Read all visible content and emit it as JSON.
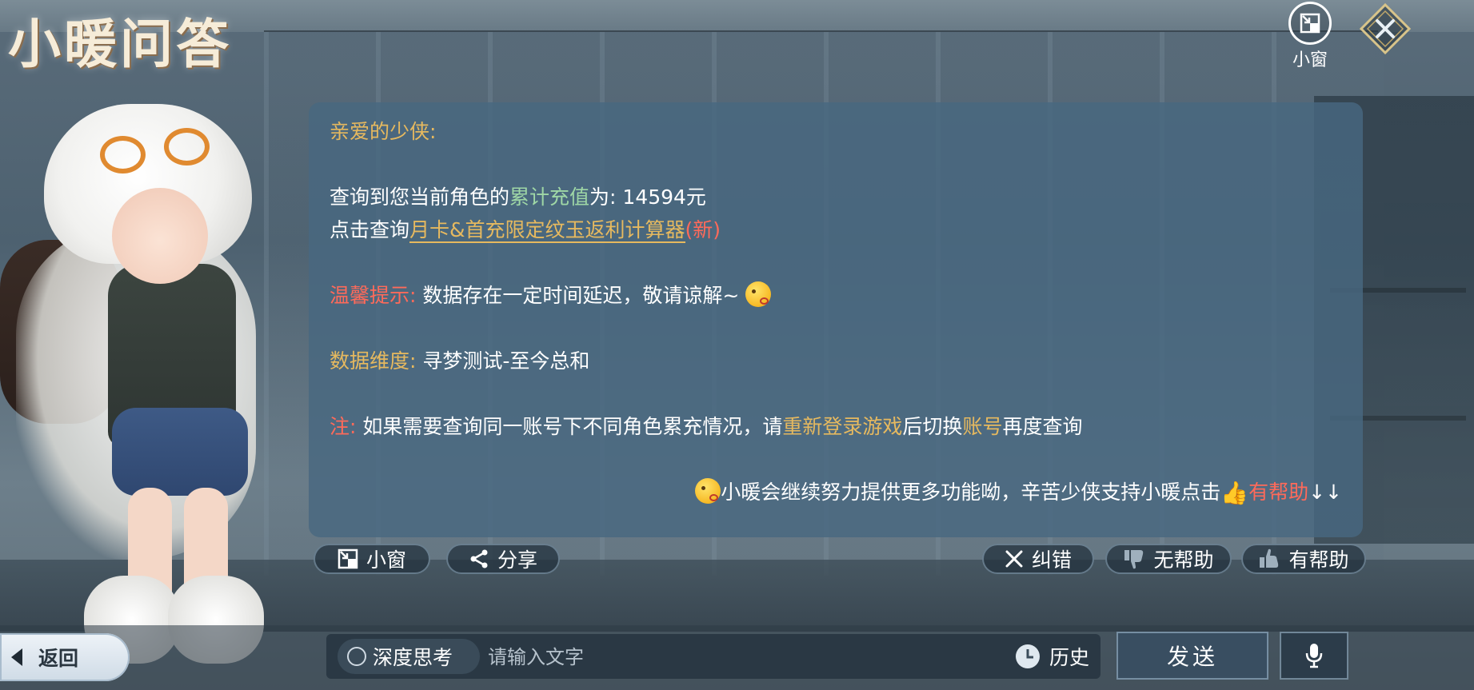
{
  "app": {
    "title": "小暖问答"
  },
  "top_controls": {
    "mini_window_label": "小窗"
  },
  "message": {
    "greeting": "亲爱的少侠:",
    "line1_prefix": "查询到您当前角色的",
    "line1_highlight": "累计充值",
    "line1_suffix": "为: 14594元",
    "line2_prefix": "点击查询",
    "line2_link": "月卡&首充限定纹玉返利计算器",
    "line2_badge": "(新)",
    "tip_label": "温馨提示:",
    "tip_text": "数据存在一定时间延迟，敬请谅解~",
    "dimension_label": "数据维度:",
    "dimension_text": "寻梦测试-至今总和",
    "note_label": "注:",
    "note_text1": "如果需要查询同一账号下不同角色累充情况，请",
    "note_highlight1": "重新登录游戏",
    "note_text2": "后切换",
    "note_highlight2": "账号",
    "note_text3": "再度查询",
    "closing_text": "小暖会继续努力提供更多功能呦，辛苦少侠支持小暖点击",
    "closing_highlight": "有帮助",
    "closing_arrows": "↓↓"
  },
  "actions": {
    "mini_window": "小窗",
    "share": "分享",
    "correct": "纠错",
    "not_helpful": "无帮助",
    "helpful": "有帮助"
  },
  "bottom": {
    "back": "返回",
    "deep_think": "深度思考",
    "input_placeholder": "请输入文字",
    "history": "历史",
    "send": "发送"
  },
  "colors": {
    "card_bg": "#48687f",
    "gold": "#e6b95f",
    "green": "#9fd7a6",
    "red": "#ff6a5a"
  }
}
